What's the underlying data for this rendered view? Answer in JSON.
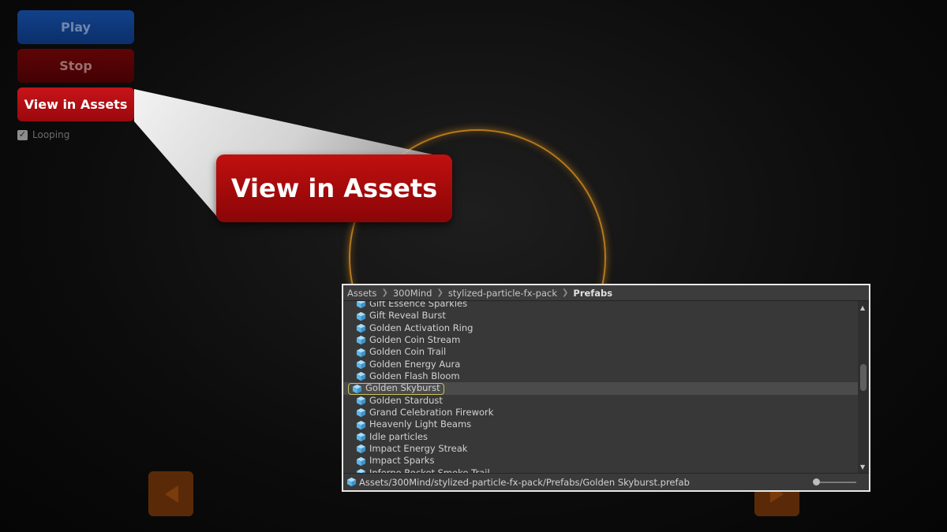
{
  "controls": {
    "play_label": "Play",
    "stop_label": "Stop",
    "view_assets_label": "View in Assets",
    "looping_label": "Looping",
    "looping_checked": true
  },
  "callout": {
    "label": "View in Assets"
  },
  "colors": {
    "play": "#12418a",
    "stop": "#5e0406",
    "view": "#c8141a",
    "ring": "#d28c1e",
    "nav": "#5a2a08",
    "selection_outline": "#c8c25a",
    "prefab_icon": "#6fc4f0"
  },
  "project_window": {
    "breadcrumb": [
      "Assets",
      "300Mind",
      "stylized-particle-fx-pack",
      "Prefabs"
    ],
    "items": [
      "Gift Essence Sparkles",
      "Gift Reveal Burst",
      "Golden Activation Ring",
      "Golden Coin Stream",
      "Golden Coin Trail",
      "Golden Energy Aura",
      "Golden Flash Bloom",
      "Golden Skyburst",
      "Golden Stardust",
      "Grand Celebration Firework",
      "Heavenly Light Beams",
      "Idle particles",
      "Impact Energy Streak",
      "Impact Sparks",
      "Inferno Rocket Smoke Trail"
    ],
    "selected_item": "Golden Skyburst",
    "item_icon": "prefab-cube-icon",
    "status_path": "Assets/300Mind/stylized-particle-fx-pack/Prefabs/Golden Skyburst.prefab"
  },
  "navigation": {
    "prev_icon": "triangle-left-icon",
    "next_icon": "triangle-right-icon"
  }
}
